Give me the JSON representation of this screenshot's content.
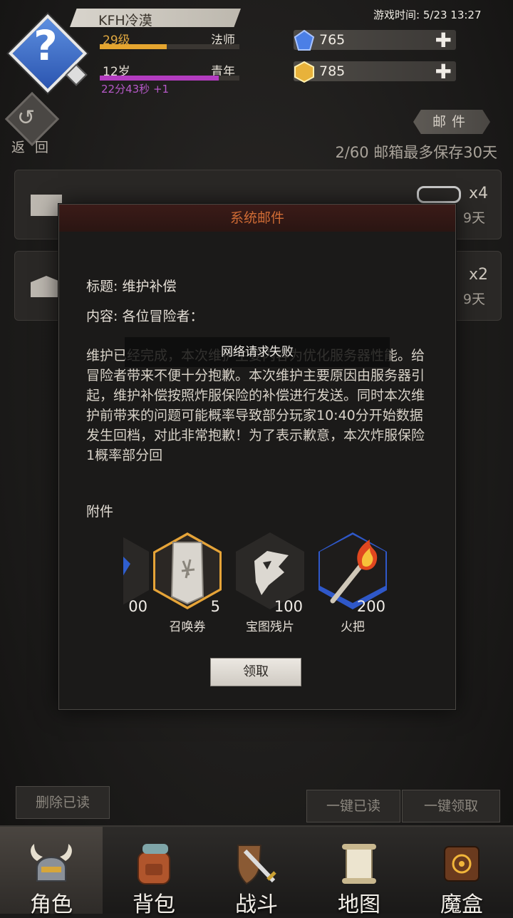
{
  "header": {
    "name": "KFH冷漠",
    "level": "29级",
    "class": "法师",
    "level_progress": 0.48,
    "age": "12岁",
    "age_stage": "青年",
    "age_progress": 0.85,
    "age_timer": "22分43秒 +1",
    "avatar_glyph": "?",
    "game_time": "游戏时间: 5/23 13:27",
    "resources": [
      {
        "icon": "blue-gem-icon",
        "value": "765",
        "color": "#4b7fe6"
      },
      {
        "icon": "gold-coin-icon",
        "value": "785",
        "color": "#e8b23a"
      }
    ]
  },
  "nav": {
    "back_label": "返 回",
    "section_tag": "邮件",
    "mail_count": "2/60 邮箱最多保存30天"
  },
  "mail_list": [
    {
      "count": "x4",
      "days": "9天",
      "has_attachment": true,
      "opened": false
    },
    {
      "count": "x2",
      "days": "9天",
      "has_attachment": false,
      "opened": true
    }
  ],
  "dialog": {
    "title": "系统邮件",
    "subject": "标题: 维护补偿",
    "content_label": "内容: 各位冒险者：",
    "body": "维护已经完成，本次维护主要内容为优化服务器性能。给冒险者带来不便十分抱歉。本次维护主要原因由服务器引起，维护补偿按照炸服保险的补偿进行发送。同时本次维护前带来的问题可能概率导致部分玩家10:40分开始数据发生回档，对此非常抱歉！为了表示歉意，本次炸服保险1概率部分回",
    "toast": "网络请求失败",
    "attach_label": "附件",
    "items": [
      {
        "name": "",
        "qty": "00",
        "icon": "blue-crystal-icon"
      },
      {
        "name": "召唤券",
        "qty": "5",
        "icon": "summon-ticket-icon"
      },
      {
        "name": "宝图残片",
        "qty": "100",
        "icon": "map-fragment-icon"
      },
      {
        "name": "火把",
        "qty": "200",
        "icon": "torch-icon"
      }
    ],
    "claim_label": "领取"
  },
  "actions": {
    "delete_read": "删除已读",
    "mark_all_read": "一键已读",
    "claim_all": "一键领取"
  },
  "tabs": [
    {
      "label": "角色",
      "icon": "helmet-icon",
      "active": true
    },
    {
      "label": "背包",
      "icon": "backpack-icon",
      "active": false
    },
    {
      "label": "战斗",
      "icon": "sword-shield-icon",
      "active": false
    },
    {
      "label": "地图",
      "icon": "scroll-map-icon",
      "active": false
    },
    {
      "label": "魔盒",
      "icon": "magic-box-icon",
      "active": false
    }
  ]
}
